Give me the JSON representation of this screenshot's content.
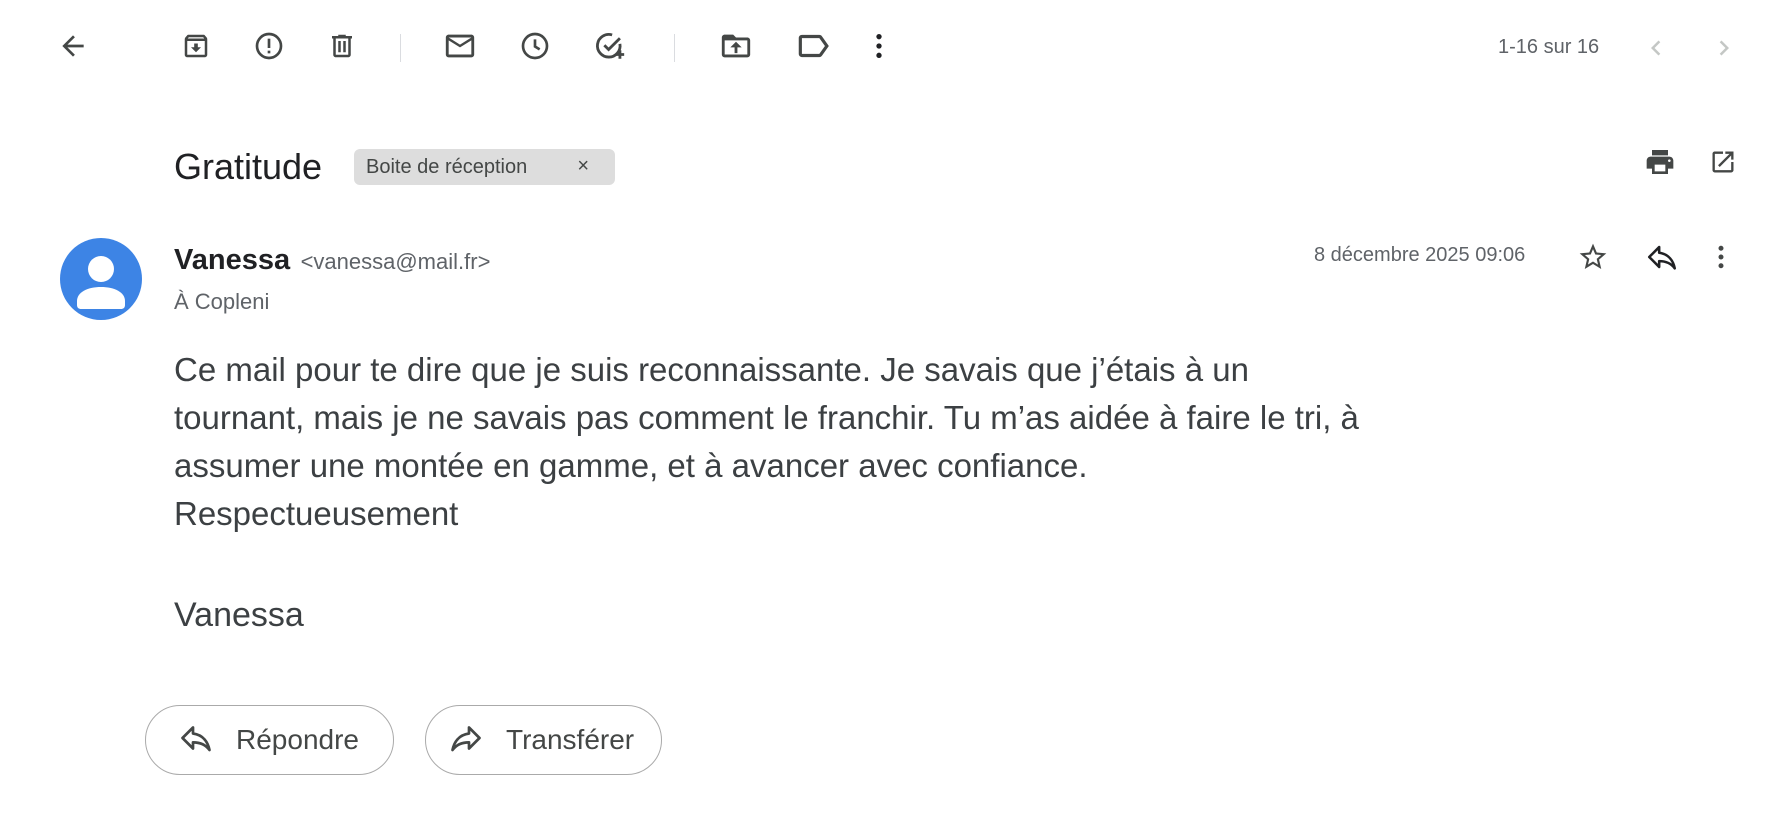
{
  "toolbar": {
    "back_icon": "arrow-left-icon",
    "archive_icon": "archive-icon",
    "spam_icon": "report-spam-icon",
    "delete_icon": "trash-icon",
    "mark_unread_icon": "mail-icon",
    "snooze_icon": "clock-icon",
    "add_task_icon": "add-task-icon",
    "move_icon": "move-to-folder-icon",
    "label_icon": "label-icon",
    "more_icon": "more-vertical-icon"
  },
  "pagination": {
    "text": "1-16 sur 16"
  },
  "message": {
    "subject": "Gratitude",
    "label": "Boite de réception",
    "label_remove": "×",
    "sender_name": "Vanessa",
    "sender_email": "<vanessa@mail.fr>",
    "recipient": "À Copleni",
    "date": "8 décembre 2025 09:06",
    "body_lines": [
      "Ce mail pour te dire que je suis reconnaissante. Je savais que j’étais à un",
      "tournant, mais je ne savais pas comment le franchir. Tu m’as aidée à faire le tri, à",
      "assumer une montée en gamme, et à avancer avec confiance.",
      "Respectueusement"
    ],
    "signature": "Vanessa"
  },
  "actions": {
    "reply_label": "Répondre",
    "forward_label": "Transférer"
  },
  "colors": {
    "avatar": "#3d84e5",
    "chip_bg": "#dddddd",
    "text_primary": "#202124",
    "text_secondary": "#5f6368"
  }
}
